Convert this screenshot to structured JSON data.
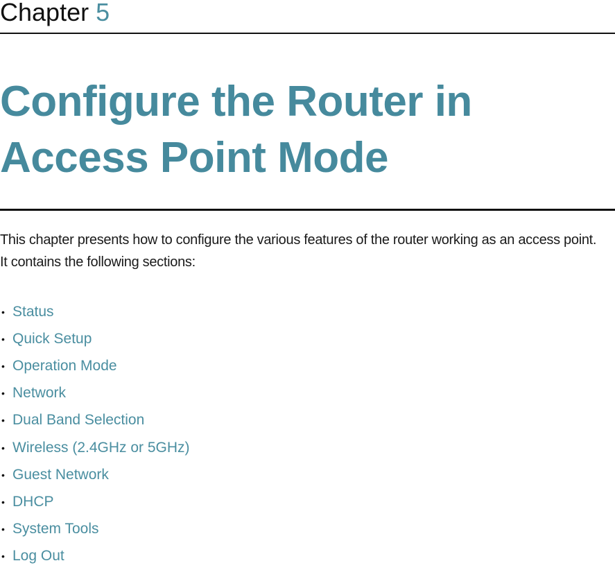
{
  "header": {
    "chapter_word": "Chapter",
    "chapter_number": "5"
  },
  "title": {
    "line1": "Configure the Router in",
    "line2": "Access Point Mode"
  },
  "intro": {
    "paragraph1": "This chapter presents how to configure the various features of the router working as an access point.",
    "paragraph2": "It contains the following sections:"
  },
  "sections": [
    {
      "label": "Status"
    },
    {
      "label": "Quick Setup"
    },
    {
      "label": "Operation Mode"
    },
    {
      "label": "Network"
    },
    {
      "label": "Dual Band Selection"
    },
    {
      "label": "Wireless (2.4GHz or 5GHz)"
    },
    {
      "label": "Guest Network"
    },
    {
      "label": "DHCP"
    },
    {
      "label": "System Tools"
    },
    {
      "label": "Log Out"
    }
  ],
  "bullet_glyph": "•",
  "colors": {
    "accent": "#468a9d",
    "text": "#1a1a1a"
  }
}
